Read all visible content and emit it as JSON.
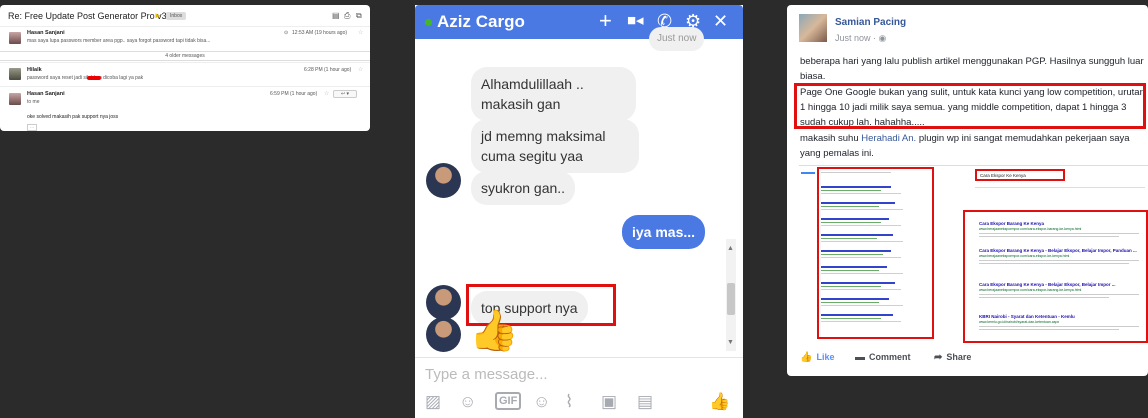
{
  "gmail": {
    "subject": "Re: Free Update Post Generator Pro v3.7",
    "label": "Inbox",
    "older_label": "4 older messages",
    "messages": [
      {
        "name": "Hasan Sanjani",
        "snippet": "mas saya lupa passwors member area pgp.. saya forgot password tapi tidak bisa...",
        "time": "12:53 AM (19 hours ago)"
      },
      {
        "name": "Hilalk",
        "snippet": "password saya reset jadi        silahkan dicoba lagi ya pak",
        "time": "6:28 PM (1 hour ago)"
      },
      {
        "name": "Hasan Sanjani",
        "to": "to me",
        "time": "6:59 PM (1 hour ago)",
        "body": "oke solved makasih pak support nya joss"
      }
    ]
  },
  "messenger": {
    "contact_name": "Aziz Cargo",
    "top_partial": "Just now",
    "messages": [
      {
        "from": "them",
        "text": "Alhamdulillaah .. makasih gan"
      },
      {
        "from": "them",
        "text": "jd memng maksimal cuma segitu yaa"
      },
      {
        "from": "them",
        "text": "syukron gan.."
      },
      {
        "from": "me",
        "text": "iya mas..."
      },
      {
        "from": "them",
        "text": "top support nya"
      }
    ],
    "input_placeholder": "Type a message..."
  },
  "facebook": {
    "author": "Samian Pacing",
    "timestamp": "Just now",
    "paragraph1": "beberapa hari yang lalu publish artikel menggunakan PGP. Hasilnya sungguh luar biasa.",
    "paragraph2": "Page One Google bukan yang sulit, untuk kata kunci yang low competition, urutan 1 hingga 10 jadi milik saya semua. yang middle competition, dapat 1 hingga 3 sudah cukup lah. hahahha.....",
    "paragraph3_prefix": "makasih suhu ",
    "paragraph3_link": "Herahadi An.",
    "paragraph3_suffix": " plugin wp ini sangat memudahkan pekerjaan saya yang pemalas ini.",
    "screenshot": {
      "search_query": "Cara Ekspor Ke Kenya",
      "results": [
        {
          "title": "Cara Ekspor Barang Ke Kenya",
          "url": "www.berajaanekspormpor.com/cara-ekspor-barang-ke-kenya.html"
        },
        {
          "title": "Cara Ekspor Barang Ke Kenya - Belajar Ekspor, Belajar Impor, Panduan ...",
          "url": "www.berajaanekspormpor.com/cara-ekspor-ke-kenya.html"
        },
        {
          "title": "Cara Ekspor Barang Ke Kenya - Belajar Ekspor, Belajar Impor ...",
          "url": "www.berajaanekspormpor.com/cara-ekspor-barang-ke-kenya.html"
        },
        {
          "title": "KBRI Nairobi - Syarat dan Ketentuan - Kemlu",
          "url": "www.kemlu.go.id/nairobi/syarat-dan-ketentuan.aspx"
        }
      ]
    },
    "actions": {
      "like": "Like",
      "comment": "Comment",
      "share": "Share"
    }
  }
}
